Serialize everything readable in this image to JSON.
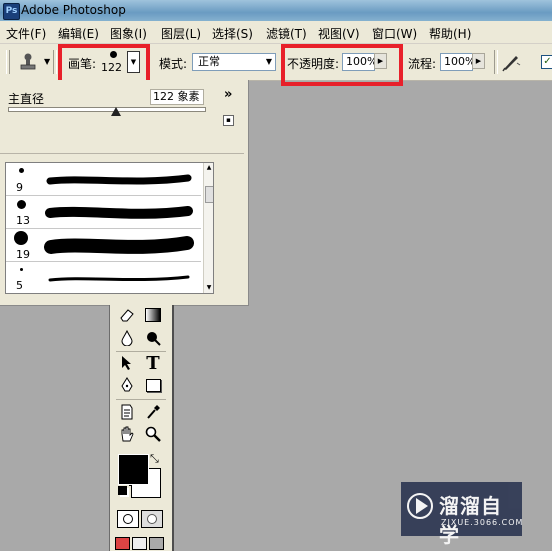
{
  "window": {
    "title": "Adobe Photoshop"
  },
  "menu": [
    "文件(F)",
    "编辑(E)",
    "图象(I)",
    "图层(L)",
    "选择(S)",
    "滤镜(T)",
    "视图(V)",
    "窗口(W)",
    "帮助(H)"
  ],
  "options": {
    "brush_label": "画笔:",
    "brush_size": "122",
    "mode_label": "模式:",
    "mode_value": "正常",
    "opacity_label": "不透明度:",
    "opacity_value": "100%",
    "flow_label": "流程:",
    "flow_value": "100%"
  },
  "brush_palette": {
    "master_diameter_label": "主直径",
    "master_diameter_value": "122 象素",
    "expand_glyph": "»",
    "slider_fraction": 0.55,
    "brushes": [
      {
        "size": "9"
      },
      {
        "size": "13"
      },
      {
        "size": "19"
      },
      {
        "size": "5"
      }
    ]
  },
  "toolbox": {
    "type_tool_glyph": "T"
  },
  "watermark": {
    "brand": "溜溜自学",
    "url": "ZIXUE.3066.COM"
  },
  "colors": {
    "highlight": "#e8202a",
    "canvas_bg": "#a9a9a9",
    "panel_bg": "#ece9d8"
  }
}
